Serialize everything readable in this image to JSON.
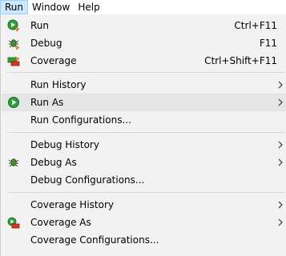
{
  "menubar": {
    "items": [
      "Run",
      "Window",
      "Help"
    ]
  },
  "menu": {
    "run": {
      "label": "Run",
      "shortcut": "Ctrl+F11",
      "icon": "run-icon"
    },
    "debug": {
      "label": "Debug",
      "shortcut": "F11",
      "icon": "debug-bug-icon"
    },
    "coverage": {
      "label": "Coverage",
      "shortcut": "Ctrl+Shift+F11",
      "icon": "coverage-icon"
    },
    "run_history": {
      "label": "Run History",
      "icon": "chevron-right-icon"
    },
    "run_as": {
      "label": "Run As",
      "icon": "run-circle-icon"
    },
    "run_configurations": {
      "label": "Run Configurations..."
    },
    "debug_history": {
      "label": "Debug History",
      "icon": "chevron-right-icon"
    },
    "debug_as": {
      "label": "Debug As",
      "icon": "debug-bug-icon"
    },
    "debug_configurations": {
      "label": "Debug Configurations..."
    },
    "coverage_history": {
      "label": "Coverage History",
      "icon": "chevron-right-icon"
    },
    "coverage_as": {
      "label": "Coverage As",
      "icon": "coverage-icon"
    },
    "coverage_configurations": {
      "label": "Coverage Configurations..."
    }
  },
  "colors": {
    "menubar_active_bg": "#cce8ff",
    "menubar_active_border": "#99d1ff",
    "hover_bg": "#e5e5e5",
    "menu_bg": "#f2f2f2",
    "run_green": "#2e9e3a"
  }
}
